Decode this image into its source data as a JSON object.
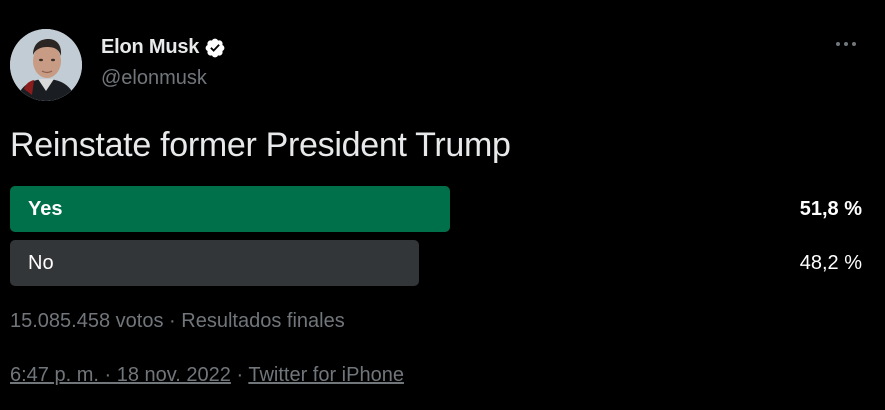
{
  "colors": {
    "background": "#000000",
    "text_primary": "#e7e9ea",
    "text_secondary": "#71767b",
    "poll_winner_bar": "#00704a",
    "poll_other_bar": "#333639",
    "verified_badge": "#ffffff"
  },
  "author": {
    "display_name": "Elon Musk",
    "handle": "@elonmusk",
    "verified_icon": "verified-badge-icon",
    "more_icon": "more-horizontal-icon"
  },
  "tweet": {
    "text": "Reinstate former President Trump"
  },
  "poll": {
    "options": [
      {
        "label": "Yes",
        "percent_text": "51,8 %",
        "fraction": 0.518,
        "winner": true
      },
      {
        "label": "No",
        "percent_text": "48,2 %",
        "fraction": 0.482,
        "winner": false
      }
    ],
    "votes_text": "15.085.458 votos",
    "separator": "·",
    "status_text": "Resultados finales"
  },
  "footer": {
    "timestamp": "6:47 p. m. · 18 nov. 2022",
    "separator": "·",
    "source": "Twitter for iPhone"
  }
}
